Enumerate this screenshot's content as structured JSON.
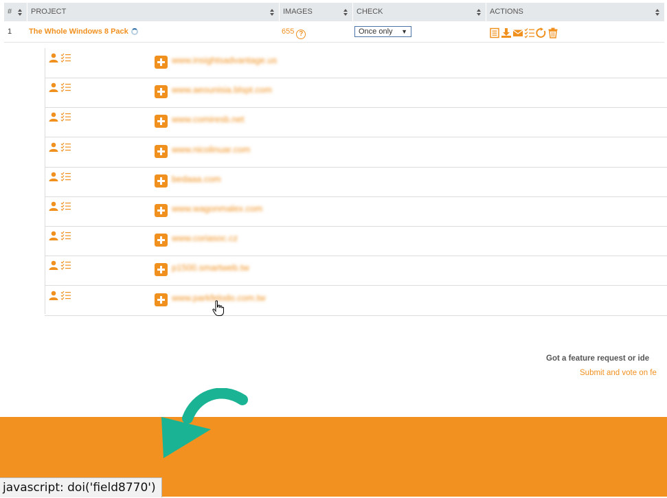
{
  "table": {
    "headers": [
      "#",
      "PROJECT",
      "IMAGES",
      "CHECK",
      "ACTIONS"
    ],
    "row": {
      "number": "1",
      "project": "The Whole Windows 8 Pack",
      "images": "655",
      "images_help_icon": "?",
      "check_value": "Once only",
      "check_arrow": "▼",
      "action_icons": [
        "list-icon",
        "download-icon",
        "envelope-icon",
        "checklist-icon",
        "refresh-icon",
        "trash-icon"
      ]
    }
  },
  "subitems": [
    "www.insightsadvantage.us",
    "www.aeounisia.blspt.com",
    "www.comiresb.net",
    "www.nicolinuar.com",
    "bedaaa.com",
    "www.wagonmalex.com",
    "www.coriasoc.cz",
    "p1500.smartweb.tw",
    "www.parkfelodo.com.tw"
  ],
  "feature": {
    "question": "Got a feature request or ide",
    "link": "Submit and vote on fe"
  },
  "status_bar": "javascript: doi('field8770')",
  "colors": {
    "accent": "#f0901e",
    "footer": "#f39120",
    "arrow": "#1ab394",
    "header_bg": "#e5e8ea"
  }
}
